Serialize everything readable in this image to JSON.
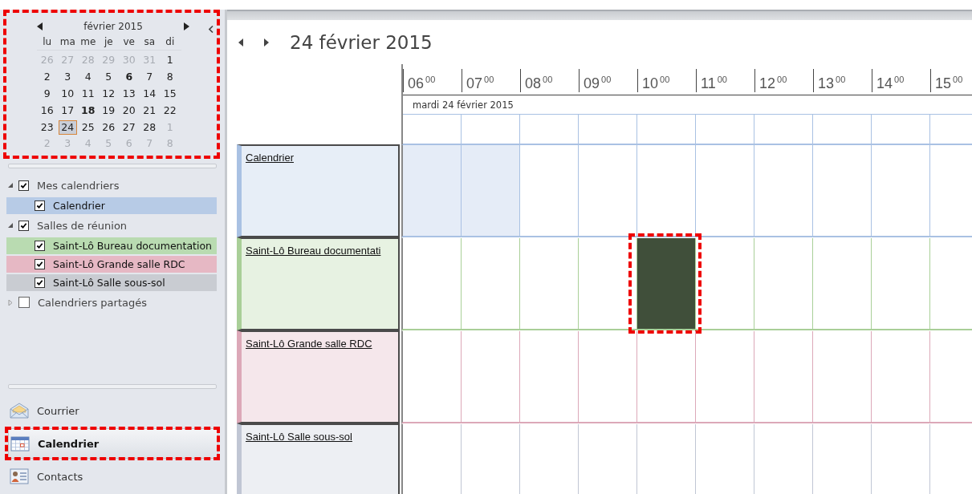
{
  "mini_calendar": {
    "month": "février 2015",
    "highlighted": true,
    "weekdays": [
      "lu",
      "ma",
      "me",
      "je",
      "ve",
      "sa",
      "di"
    ],
    "weeks": [
      [
        {
          "day": "26",
          "in_month": false,
          "bold": false,
          "selected": false
        },
        {
          "day": "27",
          "in_month": false,
          "bold": false,
          "selected": false
        },
        {
          "day": "28",
          "in_month": false,
          "bold": false,
          "selected": false
        },
        {
          "day": "29",
          "in_month": false,
          "bold": false,
          "selected": false
        },
        {
          "day": "30",
          "in_month": false,
          "bold": false,
          "selected": false
        },
        {
          "day": "31",
          "in_month": false,
          "bold": false,
          "selected": false
        },
        {
          "day": "1",
          "in_month": true,
          "bold": false,
          "selected": false
        }
      ],
      [
        {
          "day": "2",
          "in_month": true,
          "bold": false,
          "selected": false
        },
        {
          "day": "3",
          "in_month": true,
          "bold": false,
          "selected": false
        },
        {
          "day": "4",
          "in_month": true,
          "bold": false,
          "selected": false
        },
        {
          "day": "5",
          "in_month": true,
          "bold": false,
          "selected": false
        },
        {
          "day": "6",
          "in_month": true,
          "bold": true,
          "selected": false
        },
        {
          "day": "7",
          "in_month": true,
          "bold": false,
          "selected": false
        },
        {
          "day": "8",
          "in_month": true,
          "bold": false,
          "selected": false
        }
      ],
      [
        {
          "day": "9",
          "in_month": true,
          "bold": false,
          "selected": false
        },
        {
          "day": "10",
          "in_month": true,
          "bold": false,
          "selected": false
        },
        {
          "day": "11",
          "in_month": true,
          "bold": false,
          "selected": false
        },
        {
          "day": "12",
          "in_month": true,
          "bold": false,
          "selected": false
        },
        {
          "day": "13",
          "in_month": true,
          "bold": false,
          "selected": false
        },
        {
          "day": "14",
          "in_month": true,
          "bold": false,
          "selected": false
        },
        {
          "day": "15",
          "in_month": true,
          "bold": false,
          "selected": false
        }
      ],
      [
        {
          "day": "16",
          "in_month": true,
          "bold": false,
          "selected": false
        },
        {
          "day": "17",
          "in_month": true,
          "bold": false,
          "selected": false
        },
        {
          "day": "18",
          "in_month": true,
          "bold": true,
          "selected": false
        },
        {
          "day": "19",
          "in_month": true,
          "bold": false,
          "selected": false
        },
        {
          "day": "20",
          "in_month": true,
          "bold": false,
          "selected": false
        },
        {
          "day": "21",
          "in_month": true,
          "bold": false,
          "selected": false
        },
        {
          "day": "22",
          "in_month": true,
          "bold": false,
          "selected": false
        }
      ],
      [
        {
          "day": "23",
          "in_month": true,
          "bold": false,
          "selected": false
        },
        {
          "day": "24",
          "in_month": true,
          "bold": false,
          "selected": true
        },
        {
          "day": "25",
          "in_month": true,
          "bold": false,
          "selected": false
        },
        {
          "day": "26",
          "in_month": true,
          "bold": false,
          "selected": false
        },
        {
          "day": "27",
          "in_month": true,
          "bold": false,
          "selected": false
        },
        {
          "day": "28",
          "in_month": true,
          "bold": false,
          "selected": false
        },
        {
          "day": "1",
          "in_month": false,
          "bold": false,
          "selected": false
        }
      ],
      [
        {
          "day": "2",
          "in_month": false,
          "bold": false,
          "selected": false
        },
        {
          "day": "3",
          "in_month": false,
          "bold": false,
          "selected": false
        },
        {
          "day": "4",
          "in_month": false,
          "bold": false,
          "selected": false
        },
        {
          "day": "5",
          "in_month": false,
          "bold": false,
          "selected": false
        },
        {
          "day": "6",
          "in_month": false,
          "bold": false,
          "selected": false
        },
        {
          "day": "7",
          "in_month": false,
          "bold": false,
          "selected": false
        },
        {
          "day": "8",
          "in_month": false,
          "bold": false,
          "selected": false
        }
      ]
    ]
  },
  "calendar_groups": [
    {
      "label": "Mes calendriers",
      "checked": true,
      "expanded": true,
      "children": [
        {
          "label": "Calendrier",
          "checked": true,
          "color": "#b7cbe6"
        }
      ]
    },
    {
      "label": "Salles de réunion",
      "checked": true,
      "expanded": true,
      "children": [
        {
          "label": "Saint-Lô Bureau documentation",
          "checked": true,
          "color": "#b9dbb1"
        },
        {
          "label": "Saint-Lô Grande salle RDC",
          "checked": true,
          "color": "#e6b8c4"
        },
        {
          "label": "Saint-Lô Salle sous-sol",
          "checked": true,
          "color": "#c9ccd2"
        }
      ]
    },
    {
      "label": "Calendriers partagés",
      "checked": false,
      "expanded": false
    }
  ],
  "navigation": [
    {
      "label": "Courrier",
      "kind": "mail",
      "selected": false,
      "highlighted": false
    },
    {
      "label": "Calendrier",
      "kind": "calendar",
      "selected": true,
      "highlighted": true
    },
    {
      "label": "Contacts",
      "kind": "contacts",
      "selected": false,
      "highlighted": false
    }
  ],
  "date_title": "24 février 2015",
  "hours": [
    {
      "hour": "06",
      "minutes": "00"
    },
    {
      "hour": "07",
      "minutes": "00"
    },
    {
      "hour": "08",
      "minutes": "00"
    },
    {
      "hour": "09",
      "minutes": "00"
    },
    {
      "hour": "10",
      "minutes": "00"
    },
    {
      "hour": "11",
      "minutes": "00"
    },
    {
      "hour": "12",
      "minutes": "00"
    },
    {
      "hour": "13",
      "minutes": "00"
    },
    {
      "hour": "14",
      "minutes": "00"
    },
    {
      "hour": "15",
      "minutes": "00"
    }
  ],
  "day_label": "mardi 24 février 2015",
  "rows": [
    {
      "name": "Calendrier",
      "color": "#a9c1e3",
      "cells": [
        {
          "kind": "off",
          "highlighted": false
        },
        {
          "kind": "off",
          "highlighted": false
        },
        {
          "kind": "free",
          "highlighted": false
        },
        {
          "kind": "free",
          "highlighted": false
        },
        {
          "kind": "free",
          "highlighted": false
        },
        {
          "kind": "free",
          "highlighted": false
        },
        {
          "kind": "free",
          "highlighted": false
        },
        {
          "kind": "free",
          "highlighted": false
        },
        {
          "kind": "free",
          "highlighted": false
        },
        {
          "kind": "free",
          "highlighted": false
        }
      ]
    },
    {
      "name": "Saint-Lô Bureau documentati",
      "color": "#a9cf98",
      "cells": [
        {
          "kind": "free",
          "highlighted": false
        },
        {
          "kind": "free",
          "highlighted": false
        },
        {
          "kind": "free",
          "highlighted": false
        },
        {
          "kind": "free",
          "highlighted": false
        },
        {
          "kind": "busy",
          "highlighted": true
        },
        {
          "kind": "free",
          "highlighted": false
        },
        {
          "kind": "free",
          "highlighted": false
        },
        {
          "kind": "free",
          "highlighted": false
        },
        {
          "kind": "free",
          "highlighted": false
        },
        {
          "kind": "free",
          "highlighted": false
        }
      ]
    },
    {
      "name": "Saint-Lô Grande salle RDC",
      "color": "#dca8b8",
      "cells": [
        {
          "kind": "free",
          "highlighted": false
        },
        {
          "kind": "free",
          "highlighted": false
        },
        {
          "kind": "free",
          "highlighted": false
        },
        {
          "kind": "free",
          "highlighted": false
        },
        {
          "kind": "free",
          "highlighted": false
        },
        {
          "kind": "free",
          "highlighted": false
        },
        {
          "kind": "free",
          "highlighted": false
        },
        {
          "kind": "free",
          "highlighted": false
        },
        {
          "kind": "free",
          "highlighted": false
        },
        {
          "kind": "free",
          "highlighted": false
        }
      ]
    },
    {
      "name": "Saint-Lô Salle sous-sol",
      "color": "#c0c6d4",
      "cells": [
        {
          "kind": "free",
          "highlighted": false
        },
        {
          "kind": "free",
          "highlighted": false
        },
        {
          "kind": "free",
          "highlighted": false
        },
        {
          "kind": "free",
          "highlighted": false
        },
        {
          "kind": "free",
          "highlighted": false
        },
        {
          "kind": "free",
          "highlighted": false
        },
        {
          "kind": "free",
          "highlighted": false
        },
        {
          "kind": "free",
          "highlighted": false
        },
        {
          "kind": "free",
          "highlighted": false
        },
        {
          "kind": "free",
          "highlighted": false
        }
      ]
    }
  ]
}
